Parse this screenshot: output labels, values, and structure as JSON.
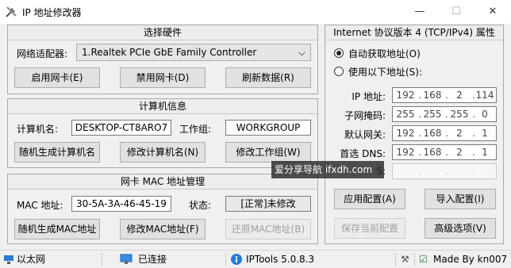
{
  "window": {
    "title": "IP 地址修改器",
    "minimize": "—",
    "maximize": "☐",
    "close": "✕"
  },
  "hardware": {
    "header": "选择硬件",
    "adapter_label": "网络适配器:",
    "adapter_value": "1.Realtek PCIe GbE Family Controller",
    "buttons": [
      "启用网卡(E)",
      "禁用网卡(D)",
      "刷新数据(R)"
    ]
  },
  "computer": {
    "header": "计算机信息",
    "name_label": "计算机名:",
    "name_value": "DESKTOP-CT8ARO7",
    "group_label": "工作组:",
    "group_value": "WORKGROUP",
    "buttons": [
      "随机生成计算机名",
      "修改计算机名(N)",
      "修改工作组(W)"
    ]
  },
  "mac": {
    "header": "网卡 MAC 地址管理",
    "mac_label": "MAC 地址:",
    "mac_value": "30-5A-3A-46-45-19",
    "status_label": "状态:",
    "status_value": "[正常]未修改",
    "buttons": [
      "随机生成MAC地址",
      "修改MAC地址(F)",
      "还原MAC地址(B)"
    ]
  },
  "ip": {
    "header": "Internet 协议版本 4 (TCP/IPv4) 属性",
    "auto_label": "自动获取地址(O)",
    "manual_label": "使用以下地址(S):",
    "rows": [
      {
        "label": "IP 地址:",
        "octets": [
          "192",
          "168",
          "2",
          "114"
        ]
      },
      {
        "label": "子网掩码:",
        "octets": [
          "255",
          "255",
          "255",
          "0"
        ]
      },
      {
        "label": "默认网关:",
        "octets": [
          "192",
          "168",
          "2",
          "1"
        ]
      },
      {
        "label": "首选 DNS:",
        "octets": [
          "192",
          "168",
          "2",
          "1"
        ]
      },
      {
        "label": "S:",
        "octets": [
          "",
          "",
          "",
          ""
        ]
      }
    ],
    "buttons": [
      "应用配置(A)",
      "导入配置(I)",
      "保存当前配置",
      "高级选项(V)"
    ]
  },
  "status": {
    "connection_type": "以太网",
    "connection_state": "已连接",
    "version": "IPTools 5.0.8.3",
    "author": "Made By kn007"
  },
  "watermark": "爱分享导航 ifxdh.com"
}
